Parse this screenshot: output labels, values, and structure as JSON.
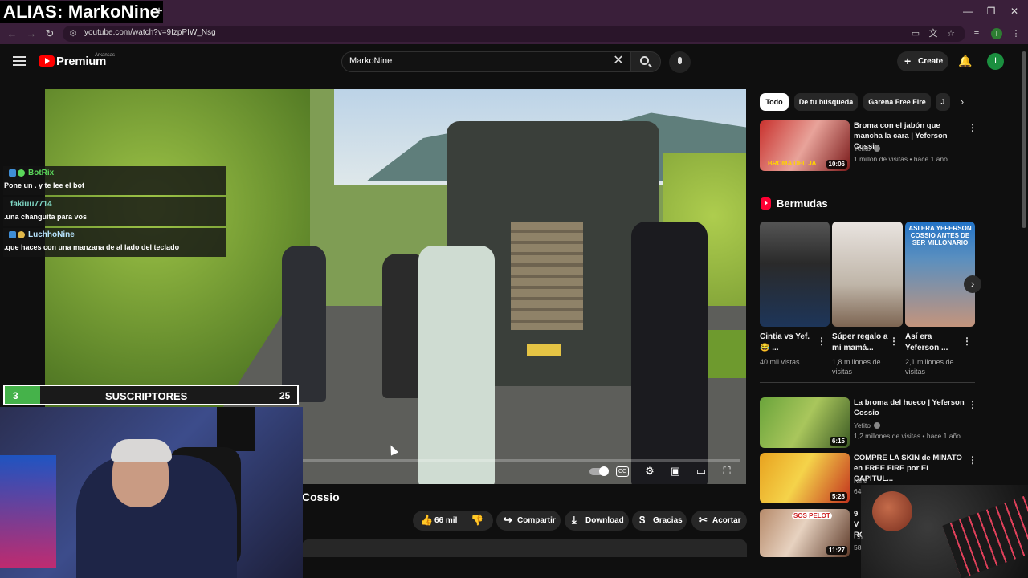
{
  "overlay": {
    "alias": "ALIAS: MarkoNine",
    "chat": [
      {
        "user": "BotRix",
        "message": "Pone un . y te lee el bot",
        "color": "#5bd65b"
      },
      {
        "user": "fakiuu7714",
        "message": ".una changuita para vos",
        "color": "#7fd6c4"
      },
      {
        "user": "LuchhoNine",
        "message": ".que haces con una manzana de al lado del teclado",
        "color": "#b9e6ff"
      }
    ],
    "subgoal": {
      "current": "3",
      "label": "SUSCRIPTORES",
      "goal": "25",
      "progress": 0.12
    }
  },
  "browser": {
    "new_tab": "+",
    "url": "youtube.com/watch?v=9IzpPIW_Nsg",
    "profile_initial": "I"
  },
  "header": {
    "brand": "Premium",
    "region": "Arkansas",
    "search_value": "MarkoNine",
    "create_label": "Create",
    "avatar_initial": "I"
  },
  "video": {
    "title_visible": "Cossio",
    "actions": {
      "like_count": "66 mil",
      "share": "Compartir",
      "download": "Download",
      "thanks": "Gracias",
      "clip": "Acortar"
    }
  },
  "sidebar": {
    "chips": [
      "Todo",
      "De tu búsqueda",
      "Garena Free Fire",
      "J"
    ],
    "top_video": {
      "title": "Broma con el jabón que mancha la cara | Yeferson Cossio",
      "channel": "Yefito",
      "meta": "1 millón de visitas • hace 1 año",
      "duration": "10:06",
      "thumb_text": "BROMA DEL JA"
    },
    "shorts_title": "Bermudas",
    "shorts": [
      {
        "title": "Cintia vs Yef. 😂 ...",
        "meta": "40 mil vistas"
      },
      {
        "title": "Súper regalo a mi mamá...",
        "meta": "1,8 millones de visitas"
      },
      {
        "title": "Así era Yeferson ...",
        "meta": "2,1 millones de visitas",
        "thumb_text": "ASI ERA YEFERSON COSSIO ANTES DE SER MILLONARIO"
      }
    ],
    "videos": [
      {
        "title": "La broma del hueco | Yeferson Cossio",
        "channel": "Yefito",
        "meta": "1,2 millones de visitas • hace 1 año",
        "duration": "6:15"
      },
      {
        "title": "COMPRE LA SKIN de MINATO en FREE FIRE por EL CAPITUL...",
        "channel": "Niriti",
        "meta": "64",
        "duration": "5:28"
      },
      {
        "title": "9 V RO",
        "channel": "Co",
        "meta": "58",
        "duration": "11:27",
        "thumb_text": "SOS PELOT"
      }
    ]
  }
}
